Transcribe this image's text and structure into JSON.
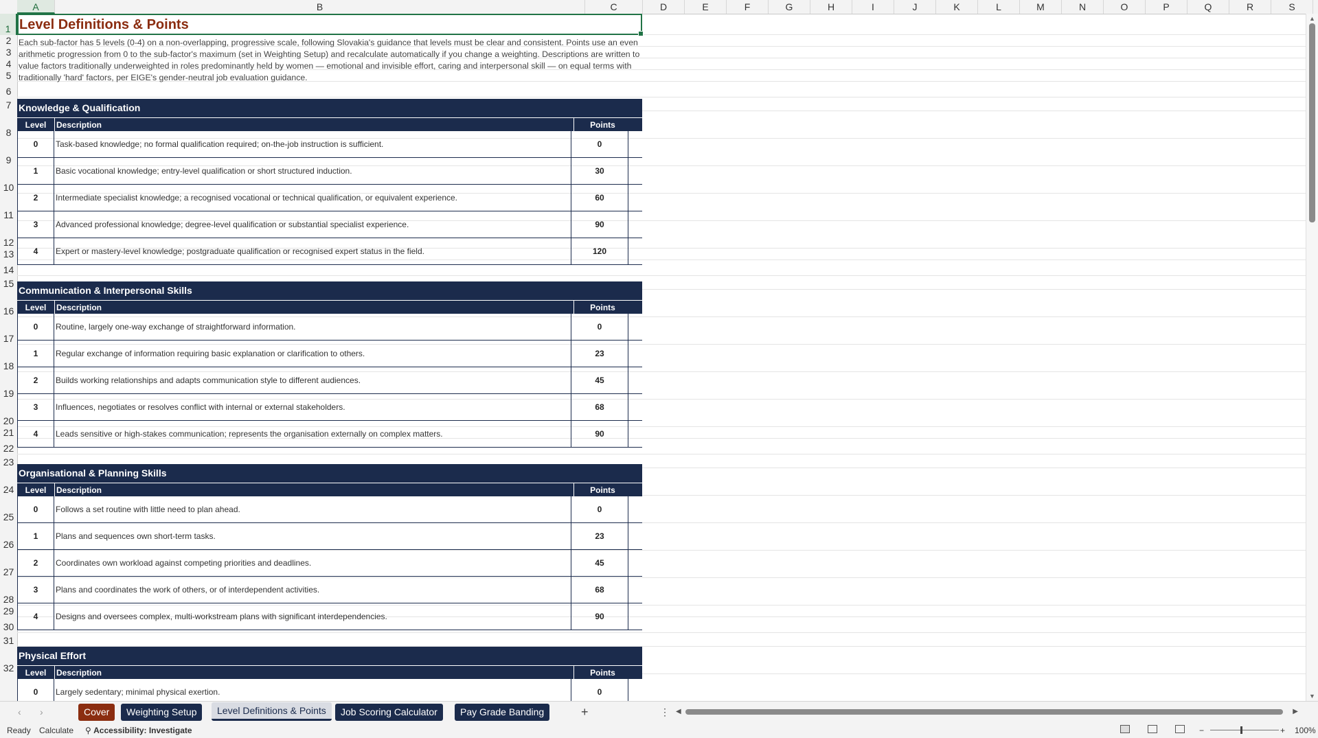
{
  "columns": [
    "A",
    "B",
    "C",
    "D",
    "E",
    "F",
    "G",
    "H",
    "I",
    "J",
    "K",
    "L",
    "M",
    "N",
    "O",
    "P",
    "Q",
    "R",
    "S"
  ],
  "selected_column": "A",
  "selected_row": "1",
  "rows": [
    "1",
    "2",
    "3",
    "4",
    "5",
    "6",
    "7",
    "8",
    "9",
    "10",
    "11",
    "12",
    "13",
    "14",
    "15",
    "16",
    "17",
    "18",
    "19",
    "20",
    "21",
    "22",
    "23",
    "24",
    "25",
    "26",
    "27",
    "28",
    "29",
    "30",
    "31",
    "32"
  ],
  "sheet": {
    "title": "Level Definitions & Points",
    "intro": "Each sub-factor has 5 levels (0-4) on a non-overlapping, progressive scale, following Slovakia's guidance that levels must be clear and consistent. Points use an even arithmetic progression from 0 to the sub-factor's maximum (set in Weighting Setup) and recalculate automatically if you change a weighting. Descriptions are written to value factors traditionally underweighted in roles predominantly held by women — emotional and invisible effort, caring and interpersonal skill — on equal terms with traditionally 'hard' factors, per EIGE's gender-neutral job evaluation guidance.",
    "header_level": "Level",
    "header_description": "Description",
    "header_points": "Points",
    "sections": [
      {
        "title": "Knowledge & Qualification",
        "rows": [
          {
            "level": "0",
            "description": "Task-based knowledge; no formal qualification required; on-the-job instruction is sufficient.",
            "points": "0"
          },
          {
            "level": "1",
            "description": "Basic vocational knowledge; entry-level qualification or short structured induction.",
            "points": "30"
          },
          {
            "level": "2",
            "description": "Intermediate specialist knowledge; a recognised vocational or technical qualification, or equivalent experience.",
            "points": "60"
          },
          {
            "level": "3",
            "description": "Advanced professional knowledge; degree-level qualification or substantial specialist experience.",
            "points": "90"
          },
          {
            "level": "4",
            "description": "Expert or mastery-level knowledge; postgraduate qualification or recognised expert status in the field.",
            "points": "120"
          }
        ]
      },
      {
        "title": "Communication & Interpersonal Skills",
        "rows": [
          {
            "level": "0",
            "description": "Routine, largely one-way exchange of straightforward information.",
            "points": "0"
          },
          {
            "level": "1",
            "description": "Regular exchange of information requiring basic explanation or clarification to others.",
            "points": "23"
          },
          {
            "level": "2",
            "description": "Builds working relationships and adapts communication style to different audiences.",
            "points": "45"
          },
          {
            "level": "3",
            "description": "Influences, negotiates or resolves conflict with internal or external stakeholders.",
            "points": "68"
          },
          {
            "level": "4",
            "description": "Leads sensitive or high-stakes communication; represents the organisation externally on complex matters.",
            "points": "90"
          }
        ]
      },
      {
        "title": "Organisational & Planning Skills",
        "rows": [
          {
            "level": "0",
            "description": "Follows a set routine with little need to plan ahead.",
            "points": "0"
          },
          {
            "level": "1",
            "description": "Plans and sequences own short-term tasks.",
            "points": "23"
          },
          {
            "level": "2",
            "description": "Coordinates own workload against competing priorities and deadlines.",
            "points": "45"
          },
          {
            "level": "3",
            "description": "Plans and coordinates the work of others, or of interdependent activities.",
            "points": "68"
          },
          {
            "level": "4",
            "description": "Designs and oversees complex, multi-workstream plans with significant interdependencies.",
            "points": "90"
          }
        ]
      },
      {
        "title": "Physical Effort",
        "rows": [
          {
            "level": "0",
            "description": "Largely sedentary; minimal physical exertion.",
            "points": "0"
          }
        ]
      }
    ]
  },
  "tabs": [
    {
      "label": "Cover",
      "active": false
    },
    {
      "label": "Weighting Setup",
      "active": false
    },
    {
      "label": "Level Definitions & Points",
      "active": true
    },
    {
      "label": "Job Scoring Calculator",
      "active": false
    },
    {
      "label": "Pay Grade Banding",
      "active": false
    }
  ],
  "status": {
    "ready": "Ready",
    "calculate": "Calculate",
    "accessibility": "Accessibility: Investigate",
    "zoom": "100%"
  },
  "colors": {
    "header_navy": "#1b2b4c",
    "title_rust": "#8b2d10",
    "excel_green": "#217346"
  }
}
